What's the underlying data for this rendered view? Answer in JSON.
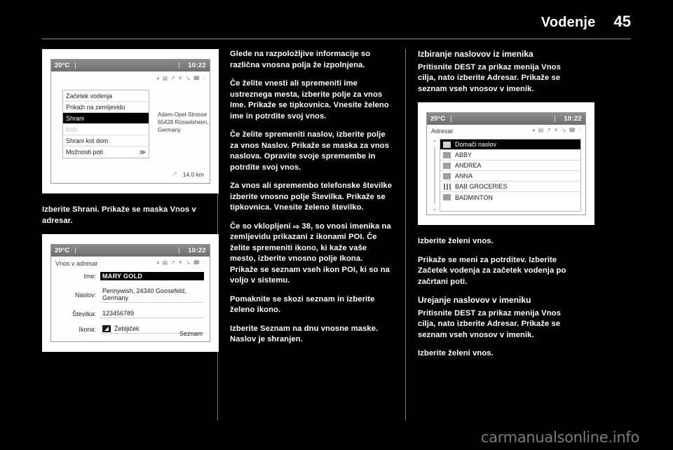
{
  "header": {
    "title": "Vodenje",
    "page_number": "45"
  },
  "watermark": "carmanualsonline.info",
  "screens": {
    "status": {
      "temperature": "20°C",
      "time": "10:22",
      "icons": [
        "wifi-icon",
        "cassette-icon",
        "signal-icon",
        "shuffle-icon",
        "mute-icon",
        "phone-icon",
        "battery-icon"
      ]
    },
    "destination_menu": {
      "items": [
        {
          "label": "Začetek vodenja",
          "state": "normal"
        },
        {
          "label": "Prikaži na zemljevidu",
          "state": "normal"
        },
        {
          "label": "Shrani",
          "state": "selected"
        },
        {
          "label": "Kliči",
          "state": "disabled"
        },
        {
          "label": "Shrani kot dom",
          "state": "normal"
        },
        {
          "label": "Možnosti poti",
          "state": "submenu",
          "arrow": "≫"
        }
      ],
      "address_line1": "Adam-Opel-Strasse",
      "address_line2": "65428 Rüsselsheim, Germany",
      "distance": "14.0 km"
    },
    "address_entry": {
      "title": "Vnos v adresar",
      "fields": [
        {
          "label": "Ime:",
          "value": "MARY GOLD",
          "highlight": true
        },
        {
          "label": "Naslov:",
          "value": "Pennywish, 24340 Goosefeld, Germany",
          "highlight": false
        },
        {
          "label": "Številka:",
          "value": "123456789",
          "highlight": false
        },
        {
          "label": "Ikona:",
          "value": "Žebljiček",
          "highlight": false,
          "icon": "poi-pin-icon"
        }
      ],
      "footer_button": "Seznam"
    },
    "address_book": {
      "title": "Adresar",
      "scroll_up": "⌃",
      "scroll_down": "⌄",
      "entries": [
        {
          "label": "Domači naslov",
          "icon": "home-icon",
          "selected": true
        },
        {
          "label": "ABBY",
          "icon": "contact-icon",
          "selected": false
        },
        {
          "label": "ANDREA",
          "icon": "contact-icon",
          "selected": false
        },
        {
          "label": "ANNA",
          "icon": "contact-icon",
          "selected": false
        },
        {
          "label": "BAB GROCERIES",
          "icon": "business-icon",
          "selected": false
        },
        {
          "label": "BADMINTON",
          "icon": "contact-icon",
          "selected": false
        }
      ]
    }
  },
  "columns": {
    "left": {
      "caption": "Izberite Shrani. Prikaže se maska Vnos v adresar."
    },
    "middle": {
      "p1": "Glede na razpoložljive informacije so različna vnosna polja že izpolnjena.",
      "p2": "Če želite vnesti ali spremeniti ime ustreznega mesta, izberite polje za vnos Ime. Prikaže se tipkovnica. Vnesite želeno ime in potrdite svoj vnos.",
      "p3": "Če želite spremeniti naslov, izberite polje za vnos Naslov. Prikaže se maska za vnos naslova. Opravite svoje spremembe in potrdite svoj vnos.",
      "p4": "Za vnos ali spremembo telefonske številke izberite vnosno polje Številka. Prikaže se tipkovnica. Vnesite želeno številko.",
      "p5_before": "Če so vklopljeni ",
      "p5_ref": "38",
      "p5_after": ", so vnosi imenika na zemljevidu prikazani z ikonami POI. Če želite spremeniti ikono, ki kaže vaše mesto, izberite vnosno polje Ikona. Prikaže se seznam vseh ikon POI, ki so na voljo v sistemu.",
      "p6": "Pomaknite se skozi seznam in izberite želeno ikono.",
      "p7": "Izberite Seznam na dnu vnosne maske. Naslov je shranjen."
    },
    "right": {
      "h1": "Izbiranje naslovov iz imenika",
      "p1": "Pritisnite DEST za prikaz menija Vnos cilja, nato izberite Adresar. Prikaže se seznam vseh vnosov v imenik.",
      "p2": "Izberite želeni vnos.",
      "p3": "Prikaže se meni za potrditev. Izberite Začetek vodenja za začetek vodenja po začrtani poti.",
      "h2": "Urejanje naslovov v imeniku",
      "p4": "Pritisnite DEST za prikaz menija Vnos cilja, nato izberite Adresar. Prikaže se seznam vseh vnosov v imenik.",
      "p5": "Izberite želeni vnos."
    }
  }
}
